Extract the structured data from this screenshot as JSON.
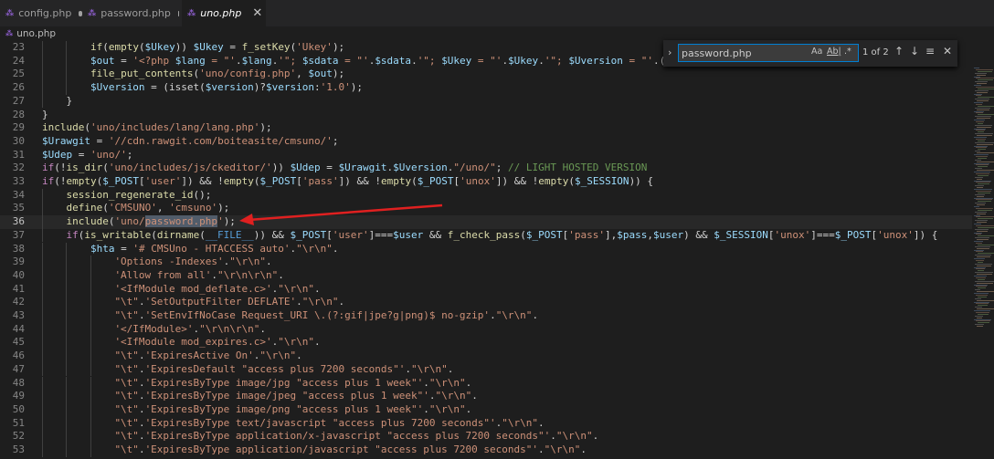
{
  "tabs": [
    {
      "label": "config.php",
      "modified": true,
      "active": false
    },
    {
      "label": "password.php",
      "modified": true,
      "active": false
    },
    {
      "label": "uno.php",
      "modified": false,
      "active": true
    }
  ],
  "breadcrumb": "uno.php",
  "find_widget": {
    "query": "password.php",
    "match_case_icon": "Aa",
    "whole_word_icon": "Ab|",
    "regex_icon": ".*",
    "result_count": "1 of 2",
    "icons": [
      "chevron-right-icon",
      "arrow-up-icon",
      "arrow-down-icon",
      "selection-icon",
      "close-icon"
    ]
  },
  "annotation": {
    "color": "#e02020",
    "points_to_line": "36"
  },
  "colors": {
    "editor_bg": "#1e1e1e",
    "accent": "#007fd4"
  },
  "lines": [
    {
      "n": "23",
      "indent": 2,
      "tokens": [
        [
          "fn",
          "if"
        ],
        [
          "op",
          "("
        ],
        [
          "fn",
          "empty"
        ],
        [
          "op",
          "("
        ],
        [
          "var",
          "$Ukey"
        ],
        [
          "op",
          ")) "
        ],
        [
          "var",
          "$Ukey"
        ],
        [
          "op",
          " = "
        ],
        [
          "fn",
          "f_setKey"
        ],
        [
          "op",
          "("
        ],
        [
          "str",
          "'Ukey'"
        ],
        [
          "op",
          ");"
        ]
      ]
    },
    {
      "n": "24",
      "indent": 2,
      "tokens": [
        [
          "var",
          "$out"
        ],
        [
          "op",
          " = "
        ],
        [
          "str",
          "'<?php "
        ],
        [
          "var",
          "$lang"
        ],
        [
          "str",
          " = \"'"
        ],
        [
          "op",
          "."
        ],
        [
          "var",
          "$lang"
        ],
        [
          "op",
          "."
        ],
        [
          "str",
          "'\"; "
        ],
        [
          "var",
          "$sdata"
        ],
        [
          "str",
          " = \"'"
        ],
        [
          "op",
          "."
        ],
        [
          "var",
          "$sdata"
        ],
        [
          "op",
          "."
        ],
        [
          "str",
          "'\"; "
        ],
        [
          "var",
          "$Ukey"
        ],
        [
          "str",
          " = \"'"
        ],
        [
          "op",
          "."
        ],
        [
          "var",
          "$Ukey"
        ],
        [
          "op",
          "."
        ],
        [
          "str",
          "'\"; "
        ],
        [
          "var",
          "$Uversion"
        ],
        [
          "str",
          " = \"'"
        ],
        [
          "op",
          ".(i"
        ]
      ]
    },
    {
      "n": "25",
      "indent": 2,
      "tokens": [
        [
          "fn",
          "file_put_contents"
        ],
        [
          "op",
          "("
        ],
        [
          "str",
          "'uno/config.php'"
        ],
        [
          "op",
          ", "
        ],
        [
          "var",
          "$out"
        ],
        [
          "op",
          ");"
        ]
      ]
    },
    {
      "n": "26",
      "indent": 2,
      "tokens": [
        [
          "var",
          "$Uversion"
        ],
        [
          "op",
          " = (isset("
        ],
        [
          "var",
          "$version"
        ],
        [
          "op",
          ")?"
        ],
        [
          "var",
          "$version"
        ],
        [
          "op",
          ":"
        ],
        [
          "str",
          "'1.0'"
        ],
        [
          "op",
          ");"
        ]
      ]
    },
    {
      "n": "27",
      "indent": 1,
      "tokens": [
        [
          "op",
          "}"
        ]
      ]
    },
    {
      "n": "28",
      "indent": 0,
      "tokens": [
        [
          "op",
          "}"
        ]
      ]
    },
    {
      "n": "29",
      "indent": 0,
      "tokens": [
        [
          "fn",
          "include"
        ],
        [
          "op",
          "("
        ],
        [
          "str",
          "'uno/includes/lang/lang.php'"
        ],
        [
          "op",
          ");"
        ]
      ]
    },
    {
      "n": "30",
      "indent": 0,
      "tokens": [
        [
          "var",
          "$Urawgit"
        ],
        [
          "op",
          " = "
        ],
        [
          "str",
          "'//cdn.rawgit.com/boiteasite/cmsuno/'"
        ],
        [
          "op",
          ";"
        ]
      ]
    },
    {
      "n": "31",
      "indent": 0,
      "tokens": [
        [
          "var",
          "$Udep"
        ],
        [
          "op",
          " = "
        ],
        [
          "str",
          "'uno/'"
        ],
        [
          "op",
          ";"
        ]
      ]
    },
    {
      "n": "32",
      "indent": 0,
      "tokens": [
        [
          "kw",
          "if"
        ],
        [
          "op",
          "(!"
        ],
        [
          "fn",
          "is_dir"
        ],
        [
          "op",
          "("
        ],
        [
          "str",
          "'uno/includes/js/ckeditor/'"
        ],
        [
          "op",
          ")) "
        ],
        [
          "var",
          "$Udep"
        ],
        [
          "op",
          " = "
        ],
        [
          "var",
          "$Urawgit"
        ],
        [
          "op",
          "."
        ],
        [
          "var",
          "$Uversion"
        ],
        [
          "op",
          "."
        ],
        [
          "str",
          "\"/uno/\""
        ],
        [
          "op",
          "; "
        ],
        [
          "cm",
          "// LIGHT HOSTED VERSION"
        ]
      ]
    },
    {
      "n": "33",
      "indent": 0,
      "tokens": [
        [
          "kw",
          "if"
        ],
        [
          "op",
          "(!"
        ],
        [
          "fn",
          "empty"
        ],
        [
          "op",
          "("
        ],
        [
          "var",
          "$_POST"
        ],
        [
          "op",
          "["
        ],
        [
          "str",
          "'user'"
        ],
        [
          "op",
          "]) && !"
        ],
        [
          "fn",
          "empty"
        ],
        [
          "op",
          "("
        ],
        [
          "var",
          "$_POST"
        ],
        [
          "op",
          "["
        ],
        [
          "str",
          "'pass'"
        ],
        [
          "op",
          "]) && !"
        ],
        [
          "fn",
          "empty"
        ],
        [
          "op",
          "("
        ],
        [
          "var",
          "$_POST"
        ],
        [
          "op",
          "["
        ],
        [
          "str",
          "'unox'"
        ],
        [
          "op",
          "]) && !"
        ],
        [
          "fn",
          "empty"
        ],
        [
          "op",
          "("
        ],
        [
          "var",
          "$_SESSION"
        ],
        [
          "op",
          ")) {"
        ]
      ]
    },
    {
      "n": "34",
      "indent": 1,
      "tokens": [
        [
          "fn",
          "session_regenerate_id"
        ],
        [
          "op",
          "();"
        ]
      ]
    },
    {
      "n": "35",
      "indent": 1,
      "tokens": [
        [
          "fn",
          "define"
        ],
        [
          "op",
          "("
        ],
        [
          "str",
          "'CMSUNO'"
        ],
        [
          "op",
          ", "
        ],
        [
          "str",
          "'cmsuno'"
        ],
        [
          "op",
          ");"
        ]
      ]
    },
    {
      "n": "36",
      "indent": 1,
      "current": true,
      "tokens": [
        [
          "fn",
          "include"
        ],
        [
          "op",
          "("
        ],
        [
          "str",
          "'uno/"
        ],
        [
          "strhl",
          "password.php"
        ],
        [
          "str",
          "'"
        ],
        [
          "op",
          ");"
        ]
      ]
    },
    {
      "n": "37",
      "indent": 1,
      "tokens": [
        [
          "kw",
          "if"
        ],
        [
          "op",
          "("
        ],
        [
          "fn",
          "is_writable"
        ],
        [
          "op",
          "("
        ],
        [
          "fn",
          "dirname"
        ],
        [
          "op",
          "("
        ],
        [
          "tag",
          "__FILE__"
        ],
        [
          "op",
          ")) && "
        ],
        [
          "var",
          "$_POST"
        ],
        [
          "op",
          "["
        ],
        [
          "str",
          "'user'"
        ],
        [
          "op",
          "]==="
        ],
        [
          "var",
          "$user"
        ],
        [
          "op",
          " && "
        ],
        [
          "fn",
          "f_check_pass"
        ],
        [
          "op",
          "("
        ],
        [
          "var",
          "$_POST"
        ],
        [
          "op",
          "["
        ],
        [
          "str",
          "'pass'"
        ],
        [
          "op",
          "],"
        ],
        [
          "var",
          "$pass"
        ],
        [
          "op",
          ","
        ],
        [
          "var",
          "$user"
        ],
        [
          "op",
          ") && "
        ],
        [
          "var",
          "$_SESSION"
        ],
        [
          "op",
          "["
        ],
        [
          "str",
          "'unox'"
        ],
        [
          "op",
          "]==="
        ],
        [
          "var",
          "$_POST"
        ],
        [
          "op",
          "["
        ],
        [
          "str",
          "'unox'"
        ],
        [
          "op",
          "]) {"
        ]
      ]
    },
    {
      "n": "38",
      "indent": 2,
      "tokens": [
        [
          "var",
          "$hta"
        ],
        [
          "op",
          " = "
        ],
        [
          "str",
          "'# CMSUno - HTACCESS auto'"
        ],
        [
          "op",
          "."
        ],
        [
          "str",
          "\"\\r\\n\""
        ],
        [
          "op",
          "."
        ]
      ]
    },
    {
      "n": "39",
      "indent": 3,
      "tokens": [
        [
          "str",
          "'Options -Indexes'"
        ],
        [
          "op",
          "."
        ],
        [
          "str",
          "\"\\r\\n\""
        ],
        [
          "op",
          "."
        ]
      ]
    },
    {
      "n": "40",
      "indent": 3,
      "tokens": [
        [
          "str",
          "'Allow from all'"
        ],
        [
          "op",
          "."
        ],
        [
          "str",
          "\"\\r\\n\\r\\n\""
        ],
        [
          "op",
          "."
        ]
      ]
    },
    {
      "n": "41",
      "indent": 3,
      "tokens": [
        [
          "str",
          "'<IfModule mod_deflate.c>'"
        ],
        [
          "op",
          "."
        ],
        [
          "str",
          "\"\\r\\n\""
        ],
        [
          "op",
          "."
        ]
      ]
    },
    {
      "n": "42",
      "indent": 3,
      "tokens": [
        [
          "str",
          "\"\\t\""
        ],
        [
          "op",
          "."
        ],
        [
          "str",
          "'SetOutputFilter DEFLATE'"
        ],
        [
          "op",
          "."
        ],
        [
          "str",
          "\"\\r\\n\""
        ],
        [
          "op",
          "."
        ]
      ]
    },
    {
      "n": "43",
      "indent": 3,
      "tokens": [
        [
          "str",
          "\"\\t\""
        ],
        [
          "op",
          "."
        ],
        [
          "str",
          "'SetEnvIfNoCase Request_URI \\.(?:gif|jpe?g|png)$ no-gzip'"
        ],
        [
          "op",
          "."
        ],
        [
          "str",
          "\"\\r\\n\""
        ],
        [
          "op",
          "."
        ]
      ]
    },
    {
      "n": "44",
      "indent": 3,
      "tokens": [
        [
          "str",
          "'</IfModule>'"
        ],
        [
          "op",
          "."
        ],
        [
          "str",
          "\"\\r\\n\\r\\n\""
        ],
        [
          "op",
          "."
        ]
      ]
    },
    {
      "n": "45",
      "indent": 3,
      "tokens": [
        [
          "str",
          "'<IfModule mod_expires.c>'"
        ],
        [
          "op",
          "."
        ],
        [
          "str",
          "\"\\r\\n\""
        ],
        [
          "op",
          "."
        ]
      ]
    },
    {
      "n": "46",
      "indent": 3,
      "tokens": [
        [
          "str",
          "\"\\t\""
        ],
        [
          "op",
          "."
        ],
        [
          "str",
          "'ExpiresActive On'"
        ],
        [
          "op",
          "."
        ],
        [
          "str",
          "\"\\r\\n\""
        ],
        [
          "op",
          "."
        ]
      ]
    },
    {
      "n": "47",
      "indent": 3,
      "tokens": [
        [
          "str",
          "\"\\t\""
        ],
        [
          "op",
          "."
        ],
        [
          "str",
          "'ExpiresDefault \"access plus 7200 seconds\"'"
        ],
        [
          "op",
          "."
        ],
        [
          "str",
          "\"\\r\\n\""
        ],
        [
          "op",
          "."
        ]
      ]
    },
    {
      "n": "48",
      "indent": 3,
      "tokens": [
        [
          "str",
          "\"\\t\""
        ],
        [
          "op",
          "."
        ],
        [
          "str",
          "'ExpiresByType image/jpg \"access plus 1 week\"'"
        ],
        [
          "op",
          "."
        ],
        [
          "str",
          "\"\\r\\n\""
        ],
        [
          "op",
          "."
        ]
      ]
    },
    {
      "n": "49",
      "indent": 3,
      "tokens": [
        [
          "str",
          "\"\\t\""
        ],
        [
          "op",
          "."
        ],
        [
          "str",
          "'ExpiresByType image/jpeg \"access plus 1 week\"'"
        ],
        [
          "op",
          "."
        ],
        [
          "str",
          "\"\\r\\n\""
        ],
        [
          "op",
          "."
        ]
      ]
    },
    {
      "n": "50",
      "indent": 3,
      "tokens": [
        [
          "str",
          "\"\\t\""
        ],
        [
          "op",
          "."
        ],
        [
          "str",
          "'ExpiresByType image/png \"access plus 1 week\"'"
        ],
        [
          "op",
          "."
        ],
        [
          "str",
          "\"\\r\\n\""
        ],
        [
          "op",
          "."
        ]
      ]
    },
    {
      "n": "51",
      "indent": 3,
      "tokens": [
        [
          "str",
          "\"\\t\""
        ],
        [
          "op",
          "."
        ],
        [
          "str",
          "'ExpiresByType text/javascript \"access plus 7200 seconds\"'"
        ],
        [
          "op",
          "."
        ],
        [
          "str",
          "\"\\r\\n\""
        ],
        [
          "op",
          "."
        ]
      ]
    },
    {
      "n": "52",
      "indent": 3,
      "tokens": [
        [
          "str",
          "\"\\t\""
        ],
        [
          "op",
          "."
        ],
        [
          "str",
          "'ExpiresByType application/x-javascript \"access plus 7200 seconds\"'"
        ],
        [
          "op",
          "."
        ],
        [
          "str",
          "\"\\r\\n\""
        ],
        [
          "op",
          "."
        ]
      ]
    },
    {
      "n": "53",
      "indent": 3,
      "tokens": [
        [
          "str",
          "\"\\t\""
        ],
        [
          "op",
          "."
        ],
        [
          "str",
          "'ExpiresByType application/javascript \"access plus 7200 seconds\"'"
        ],
        [
          "op",
          "."
        ],
        [
          "str",
          "\"\\r\\n\""
        ],
        [
          "op",
          "."
        ]
      ]
    }
  ]
}
